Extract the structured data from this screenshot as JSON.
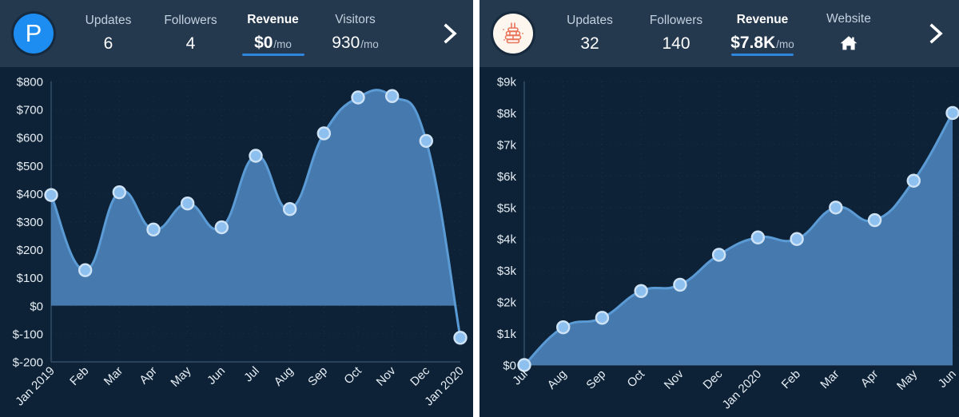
{
  "panels": [
    {
      "id": "left",
      "logo": {
        "type": "letter-avatar",
        "letter": "P",
        "bg": "#1d8df1",
        "fg": "#ffffff"
      },
      "tabs": [
        {
          "label": "Updates",
          "value": "6",
          "suffix": "",
          "active": false
        },
        {
          "label": "Followers",
          "value": "4",
          "suffix": "",
          "active": false
        },
        {
          "label": "Revenue",
          "value": "$0",
          "suffix": "/mo",
          "active": true
        },
        {
          "label": "Visitors",
          "value": "930",
          "suffix": "/mo",
          "active": false
        }
      ],
      "next_icon": "chevron-right-icon",
      "chart_ref": 0
    },
    {
      "id": "right",
      "logo": {
        "type": "hive-avatar",
        "bg": "#fdf6ee",
        "fg": "#e8745a"
      },
      "tabs": [
        {
          "label": "Updates",
          "value": "32",
          "suffix": "",
          "active": false
        },
        {
          "label": "Followers",
          "value": "140",
          "suffix": "",
          "active": false
        },
        {
          "label": "Revenue",
          "value": "$7.8K",
          "suffix": "/mo",
          "active": true
        },
        {
          "label": "Website",
          "value": "",
          "suffix": "",
          "active": false,
          "icon": "home-icon"
        }
      ],
      "next_icon": "chevron-right-icon",
      "chart_ref": 1
    }
  ],
  "colors": {
    "header_bg": "#24384e",
    "chart_bg": "#0d2236",
    "accent": "#2f86dd",
    "line": "#5b9bd5",
    "area": "#4a7fb5",
    "point_fill": "#8dc0ef",
    "point_stroke": "#cfe3f7",
    "grid": "#1d3148",
    "axis_text": "#e6edf4"
  },
  "chart_data": [
    {
      "type": "area",
      "title": "",
      "xlabel": "",
      "ylabel": "",
      "grid": true,
      "legend": "none",
      "categories": [
        "Jan 2019",
        "Feb",
        "Mar",
        "Apr",
        "May",
        "Jun",
        "Jul",
        "Aug",
        "Sep",
        "Oct",
        "Nov",
        "Dec",
        "Jan 2020"
      ],
      "values": [
        395,
        127,
        405,
        272,
        365,
        280,
        535,
        345,
        615,
        743,
        748,
        588,
        -114
      ],
      "ytick_labels": [
        "$800",
        "$700",
        "$600",
        "$500",
        "$400",
        "$300",
        "$200",
        "$100",
        "$0",
        "$-100",
        "$-200"
      ],
      "yticks": [
        800,
        700,
        600,
        500,
        400,
        300,
        200,
        100,
        0,
        -100,
        -200
      ],
      "ylim": [
        -200,
        800
      ]
    },
    {
      "type": "area",
      "title": "",
      "xlabel": "",
      "ylabel": "",
      "grid": true,
      "legend": "none",
      "categories": [
        "Jul",
        "Aug",
        "Sep",
        "Oct",
        "Nov",
        "Dec",
        "Jan 2020",
        "Feb",
        "Mar",
        "Apr",
        "May",
        "Jun"
      ],
      "values": [
        0,
        1200,
        1500,
        2350,
        2550,
        3500,
        4050,
        4000,
        5000,
        4600,
        5850,
        8000
      ],
      "ytick_labels": [
        "$9k",
        "$8k",
        "$7k",
        "$6k",
        "$5k",
        "$4k",
        "$3k",
        "$2k",
        "$1k",
        "$0"
      ],
      "yticks": [
        9000,
        8000,
        7000,
        6000,
        5000,
        4000,
        3000,
        2000,
        1000,
        0
      ],
      "ylim": [
        0,
        9000
      ]
    }
  ]
}
